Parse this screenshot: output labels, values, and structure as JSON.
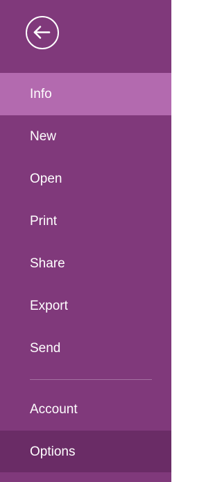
{
  "backstage": {
    "back_icon": "back-arrow-icon",
    "colors": {
      "background": "#80397b",
      "selected": "#b36aaf",
      "hovered": "#6a2c66",
      "text": "#ffffff"
    },
    "items": [
      {
        "label": "Info",
        "state": "selected"
      },
      {
        "label": "New",
        "state": "normal"
      },
      {
        "label": "Open",
        "state": "normal"
      },
      {
        "label": "Print",
        "state": "normal"
      },
      {
        "label": "Share",
        "state": "normal"
      },
      {
        "label": "Export",
        "state": "normal"
      },
      {
        "label": "Send",
        "state": "normal"
      }
    ],
    "bottom_items": [
      {
        "label": "Account",
        "state": "normal"
      },
      {
        "label": "Options",
        "state": "hovered"
      }
    ]
  }
}
